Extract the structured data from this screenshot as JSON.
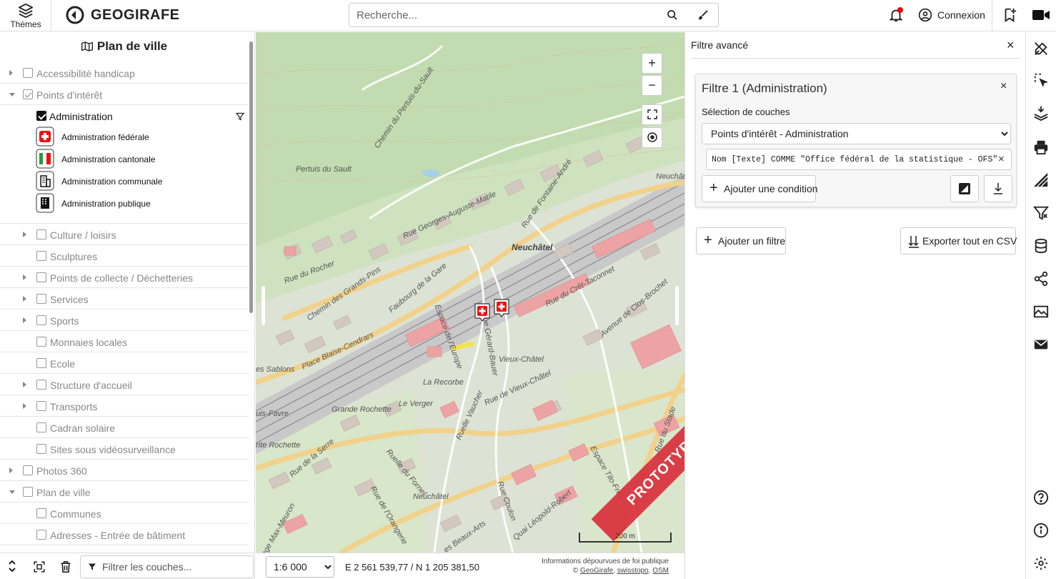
{
  "header": {
    "themes_label": "Thèmes",
    "logo_text": "GEOGIRAFE",
    "search_placeholder": "Recherche...",
    "login_label": "Connexion"
  },
  "left_panel": {
    "title": "Plan de ville",
    "tree": [
      {
        "label": "Accessibilité handicap",
        "level": 0,
        "expand": "collapsed",
        "checked": false
      },
      {
        "label": "Points d'intérêt",
        "level": 0,
        "expand": "expanded",
        "checked": true
      },
      {
        "label": "Administration",
        "level": 1,
        "expand": "none",
        "checked": true
      },
      {
        "label": "Culture / loisirs",
        "level": 1,
        "expand": "collapsed",
        "checked": false
      },
      {
        "label": "Sculptures",
        "level": 1,
        "expand": "none",
        "checked": false
      },
      {
        "label": "Points de collecte / Déchetteries",
        "level": 1,
        "expand": "collapsed",
        "checked": false
      },
      {
        "label": "Services",
        "level": 1,
        "expand": "collapsed",
        "checked": false
      },
      {
        "label": "Sports",
        "level": 1,
        "expand": "collapsed",
        "checked": false
      },
      {
        "label": "Monnaies locales",
        "level": 1,
        "expand": "none",
        "checked": false
      },
      {
        "label": "Ecole",
        "level": 1,
        "expand": "none",
        "checked": false
      },
      {
        "label": "Structure d'accueil",
        "level": 1,
        "expand": "collapsed",
        "checked": false
      },
      {
        "label": "Transports",
        "level": 1,
        "expand": "collapsed",
        "checked": false
      },
      {
        "label": "Cadran solaire",
        "level": 1,
        "expand": "none",
        "checked": false
      },
      {
        "label": "Sites sous vidéosurveillance",
        "level": 1,
        "expand": "none",
        "checked": false
      },
      {
        "label": "Photos 360",
        "level": 0,
        "expand": "collapsed",
        "checked": false
      },
      {
        "label": "Plan de ville",
        "level": 0,
        "expand": "expanded",
        "checked": false
      },
      {
        "label": "Communes",
        "level": 1,
        "expand": "none",
        "checked": false
      },
      {
        "label": "Adresses - Entrée de bâtiment",
        "level": 1,
        "expand": "none",
        "checked": false
      }
    ],
    "legend": [
      {
        "label": "Administration fédérale",
        "icon": "swiss-cross-icon"
      },
      {
        "label": "Administration cantonale",
        "icon": "canton-flag-icon"
      },
      {
        "label": "Administration communale",
        "icon": "building-icon"
      },
      {
        "label": "Administration publique",
        "icon": "office-building-icon"
      }
    ],
    "filter_placeholder": "Filtrer les couches..."
  },
  "map": {
    "labels": {
      "neuchatel_top": "Neuchâtel",
      "neuchatel_bottom": "Neuchâtel",
      "pertuis": "Pertuis du Sault",
      "chemin_pertuis": "Chemin du Pertuis-du-Sault",
      "rue_georges": "Rue Georges-Auguste-Matile",
      "rue_fontaine": "Rue de Fontaine-André",
      "rue_rocher": "Rue du Rocher",
      "chemin_pins": "Chemin des Grands-Pins",
      "faubourg": "Faubourg de la Gare",
      "espace_europe": "Espace de l'Europe",
      "rue_gerard": "Rue Gérard-Bauer",
      "rue_cret": "Rue du Crêt-Taconnet",
      "avenue_clos": "Avenue de Clos-Brochet",
      "vieux_chatel": "Vieux-Châtel",
      "rue_vieux": "Rue de Vieux-Châtel",
      "place_blaise": "Place Blaise-Cendrars",
      "sablons": "es Sablons",
      "la_recorbe": "La Recorbe",
      "ruelle_vaucher": "Ruelle Vaucher",
      "le_verger": "Le Verger",
      "grande_rochette": "Grande Rochette",
      "rite_rochette": "rite Rochette",
      "uis_favre": "uis-Favre",
      "rue_serre": "Rue de la Serre",
      "ruelle_fornel": "Ruelle du Fornel",
      "rue_orangerie": "Rue de l'Orangerie",
      "rue_coulon": "Rue Coulon",
      "quai_leopold": "Quai Léopold-Robert",
      "espace_tilo": "Espace Tilo-Frey",
      "beaux_arts": "es Beaux-Arts",
      "rue_stade": "Rue du Stade",
      "rue_max": "age Max-Meuron",
      "neuchat_right": "Neuchât"
    },
    "prototype_label": "PROTOTYPE",
    "scale_bar_label": "200 m",
    "zoom_in": "+",
    "zoom_out": "−",
    "scale_selected": "1:6 000",
    "coordinates": "E 2 561 539,77 / N 1 205 381,50",
    "attribution_line1": "Informations dépourvues de foi publique",
    "attribution_prefix": "©",
    "attribution_links": [
      "GeoGirafe",
      "swisstopo",
      "OSM"
    ],
    "colors": {
      "buildings": "#e8a0a0",
      "roads": "#f4d48a",
      "forest": "#b9d8a8",
      "rail": "#8a8a8a"
    }
  },
  "filter_panel": {
    "title": "Filtre avancé",
    "close": "×",
    "card": {
      "title": "Filtre 1 (Administration)",
      "close": "×",
      "layer_select_label": "Sélection de couches",
      "layer_selected": "Points d'intérêt - Administration",
      "condition": "Nom [Texte] COMME \"Office fédéral de la statistique - OFS\"",
      "condition_remove": "×",
      "add_condition": "Ajouter une condition"
    },
    "add_filter": "Ajouter un filtre",
    "export_csv": "Exporter tout en CSV"
  }
}
